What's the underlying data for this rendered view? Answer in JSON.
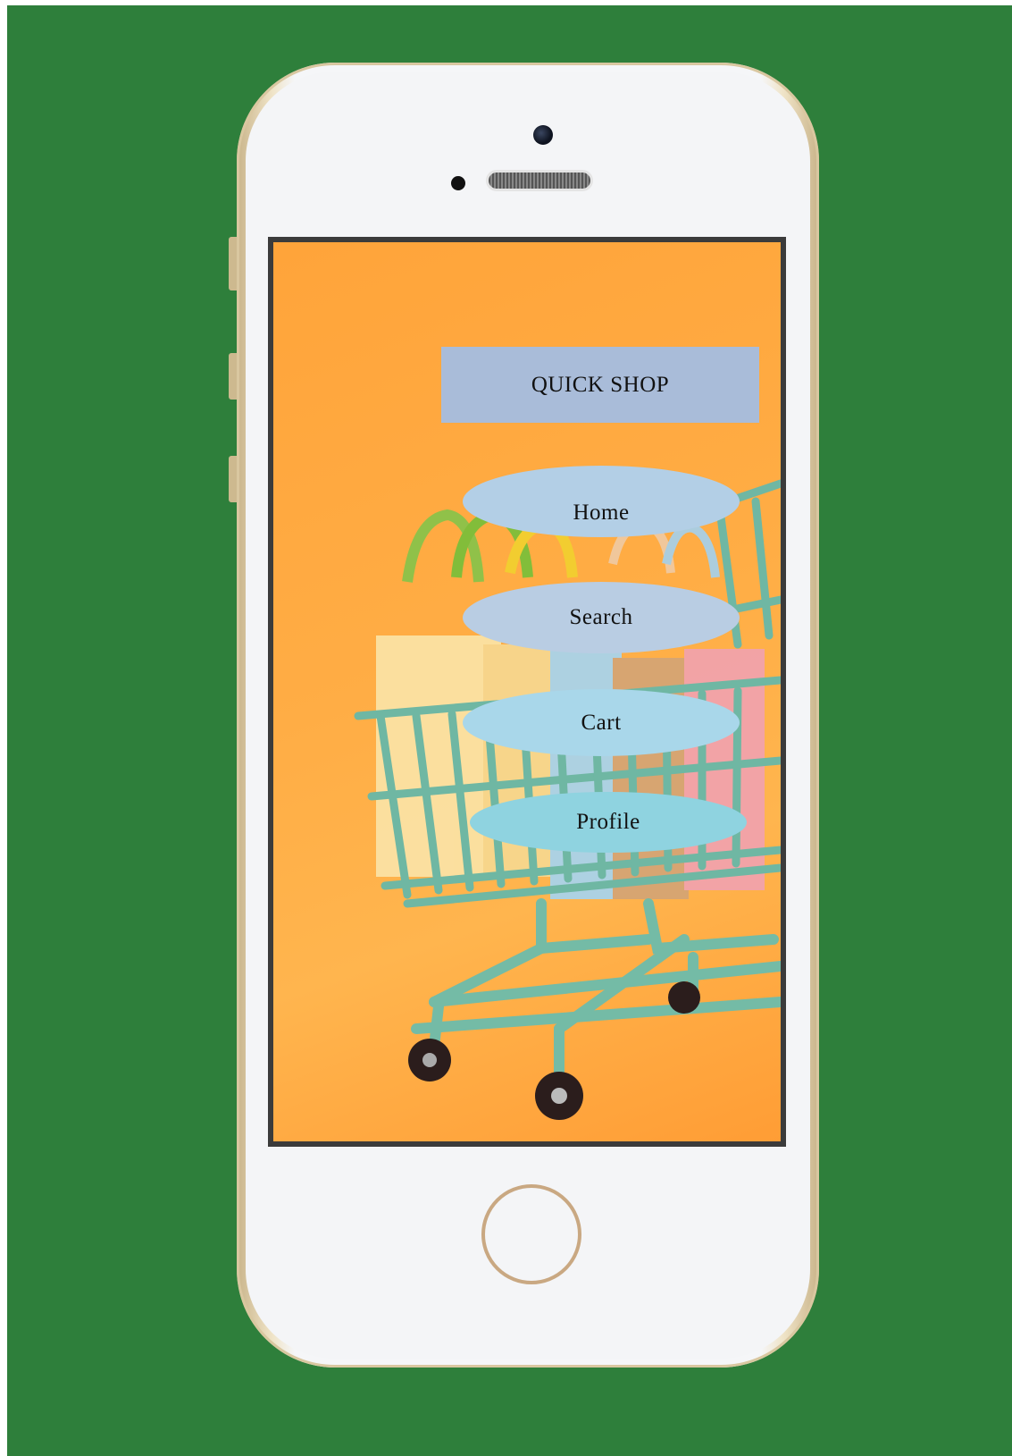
{
  "app": {
    "title": "QUICK SHOP"
  },
  "nav": [
    {
      "label": "Home",
      "color": "#b3cfe6"
    },
    {
      "label": "Search",
      "color": "#b9cde3"
    },
    {
      "label": "Cart",
      "color": "#a9d7ea"
    },
    {
      "label": "Profile",
      "color": "#8fd3e0"
    }
  ],
  "colors": {
    "background": "#2e7f3b",
    "screen": "#ffa43a",
    "title_box": "#a9bcd9"
  },
  "illustration": "shopping-cart-with-bags"
}
